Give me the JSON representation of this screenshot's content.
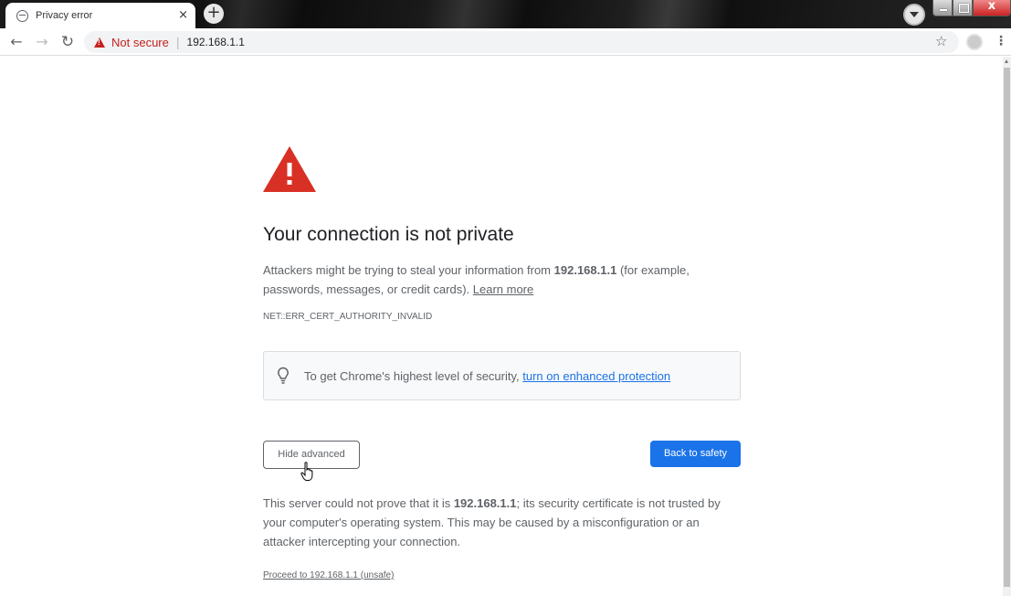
{
  "tab": {
    "title": "Privacy error",
    "close": "×",
    "new_tab": "+"
  },
  "window_controls": {
    "close": "x"
  },
  "toolbar": {
    "security_label": "Not secure",
    "separator": "|",
    "url": "192.168.1.1"
  },
  "main": {
    "heading": "Your connection is not private",
    "explanation_prefix": "Attackers might be trying to steal your information from ",
    "explanation_host": "192.168.1.1",
    "explanation_suffix": " (for example, passwords, messages, or credit cards). ",
    "learn_more": "Learn more",
    "error_code": "NET::ERR_CERT_AUTHORITY_INVALID",
    "enhanced_text": "To get Chrome's highest level of security, ",
    "enhanced_link": "turn on enhanced protection",
    "hide_advanced": "Hide advanced",
    "back_to_safety": "Back to safety",
    "details_prefix": "This server could not prove that it is ",
    "details_host": "192.168.1.1",
    "details_suffix": "; its security certificate is not trusted by your computer's operating system. This may be caused by a misconfiguration or an attacker intercepting your connection.",
    "proceed_link": "Proceed to 192.168.1.1 (unsafe)"
  },
  "colors": {
    "warning_red": "#d93025",
    "primary_blue": "#1a73e8",
    "text_gray": "#5f6368"
  }
}
